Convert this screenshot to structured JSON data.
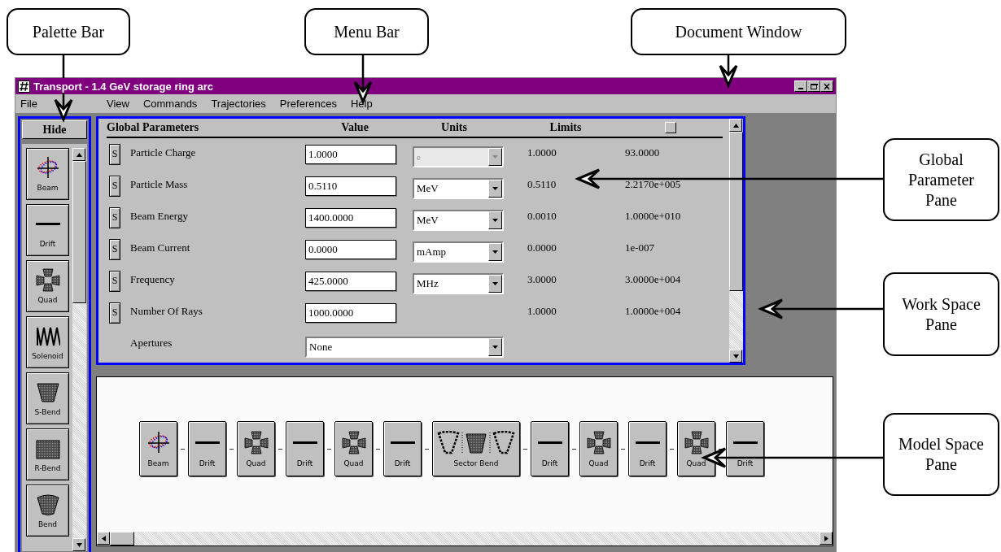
{
  "window": {
    "title": "Transport - 1.4 GeV storage ring arc"
  },
  "menu": [
    {
      "label": "File"
    },
    {
      "label": "View"
    },
    {
      "label": "Commands"
    },
    {
      "label": "Trajectories"
    },
    {
      "label": "Preferences"
    },
    {
      "label": "Help"
    }
  ],
  "palette": {
    "hide_button": "Hide",
    "items": [
      {
        "label": "Beam",
        "kind": "beam"
      },
      {
        "label": "Drift",
        "kind": "drift"
      },
      {
        "label": "Quad",
        "kind": "quad"
      },
      {
        "label": "Solenoid",
        "kind": "solenoid"
      },
      {
        "label": "S-Bend",
        "kind": "sbend"
      },
      {
        "label": "R-Bend",
        "kind": "rbend"
      },
      {
        "label": "Bend",
        "kind": "bend"
      }
    ]
  },
  "parameters": {
    "columns": [
      "Global Parameters",
      "Value",
      "Units",
      "Limits"
    ],
    "rows": [
      {
        "kind": "numeric",
        "s_button": "S",
        "name": "Particle Charge",
        "value": "1.0000",
        "unit": "e",
        "unit_disabled": true,
        "limit_min": "1.0000",
        "limit_max": "93.0000"
      },
      {
        "kind": "numeric",
        "s_button": "S",
        "name": "Particle Mass",
        "value": "0.5110",
        "unit": "MeV",
        "unit_disabled": false,
        "limit_min": "0.5110",
        "limit_max": "2.2170e+005"
      },
      {
        "kind": "numeric",
        "s_button": "S",
        "name": "Beam Energy",
        "value": "1400.0000",
        "unit": "MeV",
        "unit_disabled": false,
        "limit_min": "0.0010",
        "limit_max": "1.0000e+010"
      },
      {
        "kind": "numeric",
        "s_button": "S",
        "name": "Beam Current",
        "value": "0.0000",
        "unit": "mAmp",
        "unit_disabled": false,
        "limit_min": "0.0000",
        "limit_max": "1e-007"
      },
      {
        "kind": "numeric",
        "s_button": "S",
        "name": "Frequency",
        "value": "425.0000",
        "unit": "MHz",
        "unit_disabled": false,
        "limit_min": "3.0000",
        "limit_max": "3.0000e+004"
      },
      {
        "kind": "count",
        "s_button": "S",
        "name": "Number Of Rays",
        "value": "1000.0000",
        "limit_min": "1.0000",
        "limit_max": "1.0000e+004"
      },
      {
        "kind": "choice",
        "name": "Apertures",
        "value": "None"
      }
    ]
  },
  "model": {
    "elements": [
      {
        "label": "Beam",
        "kind": "beam"
      },
      {
        "label": "Drift",
        "kind": "drift"
      },
      {
        "label": "Quad",
        "kind": "quad"
      },
      {
        "label": "Drift",
        "kind": "drift"
      },
      {
        "label": "Quad",
        "kind": "quad"
      },
      {
        "label": "Drift",
        "kind": "drift"
      },
      {
        "label": "Sector Bend",
        "kind": "sector"
      },
      {
        "label": "Drift",
        "kind": "drift"
      },
      {
        "label": "Quad",
        "kind": "quad"
      },
      {
        "label": "Drift",
        "kind": "drift"
      },
      {
        "label": "Quad",
        "kind": "quad"
      },
      {
        "label": "Drift",
        "kind": "drift"
      }
    ]
  },
  "callouts": [
    {
      "label": "Palette Bar"
    },
    {
      "label": "Menu Bar"
    },
    {
      "label": "Document Window"
    },
    {
      "label": "Global Parameter Pane"
    },
    {
      "label": "Work Space Pane"
    },
    {
      "label": "Model Space Pane"
    }
  ]
}
